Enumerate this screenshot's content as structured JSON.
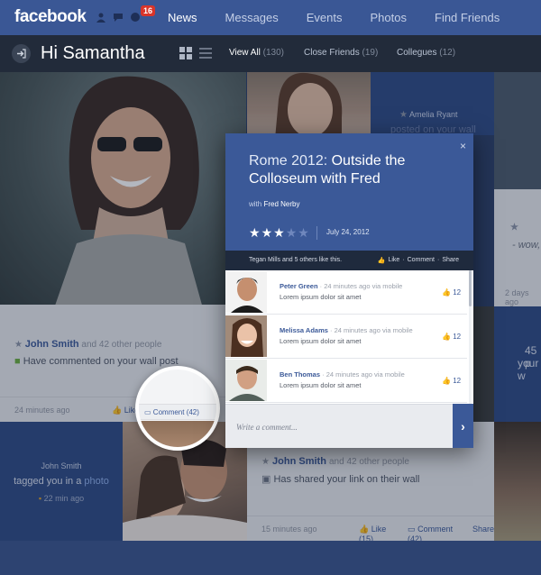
{
  "brand": {
    "logo": "facebook",
    "accent": "#3b5998",
    "dark": "#222b3a"
  },
  "nav": {
    "notifications_badge": "16",
    "links": [
      "News",
      "Messages",
      "Events",
      "Photos",
      "Find Friends"
    ]
  },
  "subbar": {
    "greeting": "Hi Samantha",
    "filters": [
      {
        "label": "View All",
        "count": "(130)"
      },
      {
        "label": "Close Friends",
        "count": "(19)"
      },
      {
        "label": "Collegues",
        "count": "(12)"
      }
    ]
  },
  "card_left": {
    "name": "John Smith",
    "others": "and 42 other people",
    "text": "Have commented on your wall post",
    "time": "24 minutes ago",
    "like": "Like (5)"
  },
  "magnifier": {
    "comment": "Comment (42)",
    "extra": "S"
  },
  "tagged_tile": {
    "name": "John Smith",
    "text_prefix": "tagged you in a",
    "link": "photo",
    "time": "22 min ago"
  },
  "card_mid": {
    "name": "John Smith",
    "others": "and 42 other people",
    "text": "Has shared your link on their wall",
    "time": "15 minutes ago",
    "like": "Like (15)",
    "comment": "Comment (42)",
    "share": "Share"
  },
  "amelia": {
    "name": "Amelia Ryant",
    "text": "posted on your wall"
  },
  "right_edge": {
    "t1": "",
    "t2": "- wow,",
    "t3": "",
    "t4": "2 days ago"
  },
  "right_blue": {
    "n": "45 p",
    "y": "your w"
  },
  "modal": {
    "title_main": "Rome 2012: ",
    "title_rest": "Outside the Colloseum with Fred",
    "with_prefix": "with",
    "with_name": "Fred Nerby",
    "rating": 3,
    "rating_max": 5,
    "date": "July 24, 2012",
    "likes_text": "Tegan Mills and 5 others like this.",
    "actions": [
      "Like",
      "Comment",
      "Share"
    ],
    "comments": [
      {
        "name": "Peter Green",
        "meta": "· 24 minutes ago via mobile",
        "text": "Lorem ipsum dolor sit amet",
        "likes": "12"
      },
      {
        "name": "Melissa Adams",
        "meta": "· 24 minutes ago via mobile",
        "text": "Lorem ipsum dolor sit amet",
        "likes": "12"
      },
      {
        "name": "Ben Thomas",
        "meta": "· 24 minutes ago via mobile",
        "text": "Lorem ipsum dolor sit amet",
        "likes": "12"
      }
    ],
    "comment_placeholder": "Write a comment...",
    "close": "×"
  }
}
